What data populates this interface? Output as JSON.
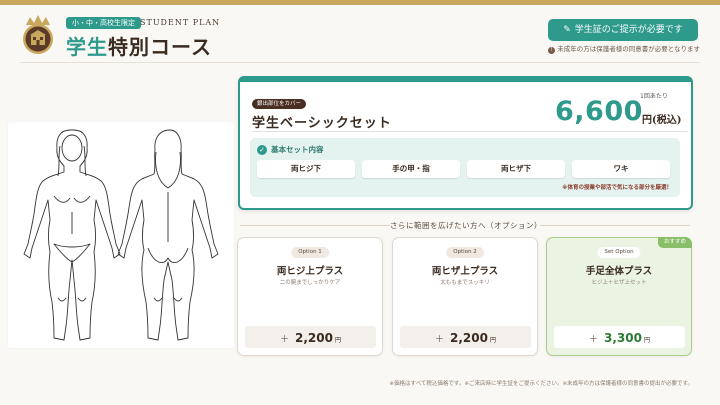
{
  "header": {
    "target_tag": "小・中・高校生限定",
    "english_tag": "STUDENT PLAN",
    "title_accent": "学生",
    "title_rest": "特別コース",
    "id_badge": "学生証のご提示が必要です",
    "minor_note": "未成年の方は保護者様の同意書が必要となります"
  },
  "main_set": {
    "cover_tag": "銀出部位をカバー",
    "name": "学生ベーシックセット",
    "per_visit": "1回あたり",
    "price": "6,600",
    "price_unit": "円(税込)",
    "included_label": "基本セット内容",
    "included_items": [
      "両ヒジ下",
      "手の甲・指",
      "両ヒザ下",
      "ワキ"
    ],
    "included_note": "※体育の授業や部活で気になる部分を厳選！"
  },
  "options": {
    "heading": "さらに範囲を広げたい方へ（オプション）",
    "items": [
      {
        "badge": "Option 1",
        "name": "両ヒジ上プラス",
        "desc": "二の腕までしっかりケア",
        "plus": "＋",
        "price": "2,200",
        "unit": "円"
      },
      {
        "badge": "Option 2",
        "name": "両ヒザ上プラス",
        "desc": "太ももまでスッキリ",
        "plus": "＋",
        "price": "2,200",
        "unit": "円"
      },
      {
        "badge": "Set Option",
        "name": "手足全体プラス",
        "desc": "ヒジ上＋ヒザ上セット",
        "plus": "＋",
        "price": "3,300",
        "unit": "円",
        "recommend": "おすすめ"
      }
    ]
  },
  "footnote": "※価格はすべて税込価格です。※ご来店時に学生証をご提示ください。※未成年の方は保護者様の同意書の提出が必要です。",
  "colors": {
    "accent": "#2e9a8c",
    "gold": "#c9a75c",
    "dark": "#3a2a20",
    "featured_bg": "#ebf3e2"
  }
}
